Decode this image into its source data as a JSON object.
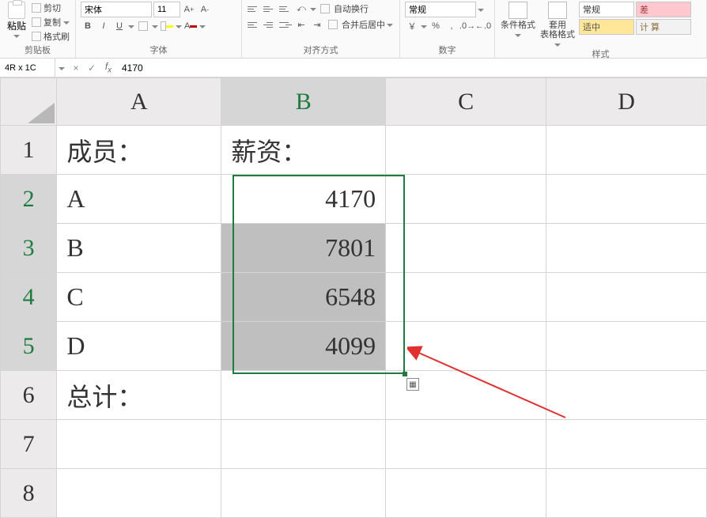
{
  "ribbon": {
    "clipboard": {
      "paste": "粘贴",
      "cut": "剪切",
      "copy": "复制",
      "format_painter": "格式刷",
      "group": "剪贴板"
    },
    "font": {
      "name": "宋体",
      "size": "11",
      "group": "字体"
    },
    "align": {
      "wrap": "自动换行",
      "merge": "合并后居中",
      "group": "对齐方式"
    },
    "number": {
      "format": "常规",
      "group": "数字"
    },
    "styles": {
      "cond": "条件格式",
      "table": "套用\n表格格式",
      "normal": "常规",
      "good": "适中",
      "bad": "差",
      "calc": "计 算",
      "group": "样式"
    }
  },
  "formula_bar": {
    "name_box": "4R x 1C",
    "value": "4170"
  },
  "columns": {
    "A": "A",
    "B": "B",
    "C": "C",
    "D": "D"
  },
  "rows": [
    "1",
    "2",
    "3",
    "4",
    "5",
    "6",
    "7",
    "8"
  ],
  "cells": {
    "A1": "成员：",
    "B1": "薪资：",
    "A2": "A",
    "B2": "4170",
    "A3": "B",
    "B3": "7801",
    "A4": "C",
    "B4": "6548",
    "A5": "D",
    "B5": "4099",
    "A6": "总计："
  }
}
